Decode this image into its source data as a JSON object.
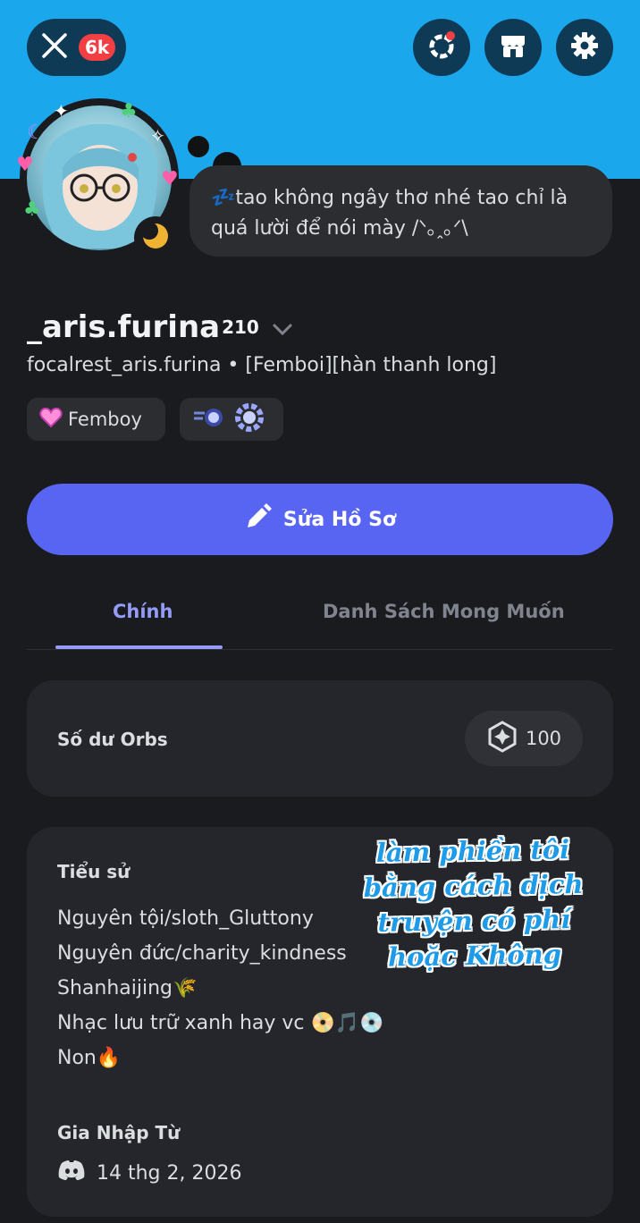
{
  "header": {
    "notification_count": "6k"
  },
  "status": {
    "text": "💤tao không ngây thơ nhé tao chỉ là quá lười để nói mày /ᐠ｡ꞈ｡ᐟ\\"
  },
  "profile": {
    "display_name": "_aris.furina",
    "superscript": "210",
    "subline": "focalrest_aris.furina • [Femboi][hàn thanh long]",
    "tag_label": "Femboy"
  },
  "actions": {
    "edit_profile": "Sửa Hồ Sơ"
  },
  "tabs": [
    {
      "label": "Chính",
      "active": true
    },
    {
      "label": "Danh Sách Mong Muốn",
      "active": false
    }
  ],
  "orbs": {
    "label": "Số dư Orbs",
    "balance": "100"
  },
  "bio": {
    "title": "Tiểu sử",
    "lines": [
      "Nguyên tội/sloth_Gluttony",
      "Nguyên đức/charity_kindness",
      "Shanhaijing🌾",
      "Nhạc lưu trữ xanh hay vc 📀🎵💿",
      "Non🔥"
    ],
    "overlay_text": "làm phiền tôi bằng cách dịch truyện có phí hoặc Không"
  },
  "joined": {
    "title": "Gia Nhập Từ",
    "date": "14 thg 2, 2026"
  },
  "colors": {
    "banner": "#1aa7ec",
    "background": "#1a1b1f",
    "accent": "#5865f2",
    "tab_active": "#949cf7"
  }
}
